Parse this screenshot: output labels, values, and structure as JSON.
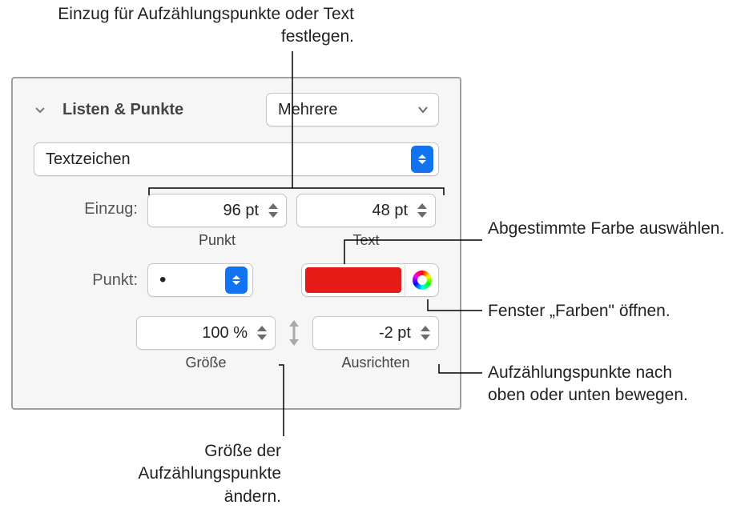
{
  "callouts": {
    "top": "Einzug für Aufzählungspunkte oder Text festlegen.",
    "right1": "Abgestimmte Farbe auswählen.",
    "right2": "Fenster „Farben\" öffnen.",
    "right3": "Aufzählungspunkte nach oben oder unten bewegen.",
    "bottom": "Größe der Aufzählungspunkte ändern."
  },
  "panel": {
    "sectionTitle": "Listen & Punkte",
    "styleSelect": "Mehrere",
    "typeSelect": "Textzeichen",
    "einzugLabel": "Einzug:",
    "indent": {
      "punkt": "96 pt",
      "text": "48 pt"
    },
    "indentSub": {
      "punkt": "Punkt",
      "text": "Text"
    },
    "punktLabel": "Punkt:",
    "bulletSymbol": "•",
    "colorSwatchHex": "#e41b17",
    "size": "100 %",
    "align": "-2 pt",
    "sizeSub": "Größe",
    "alignSub": "Ausrichten"
  }
}
